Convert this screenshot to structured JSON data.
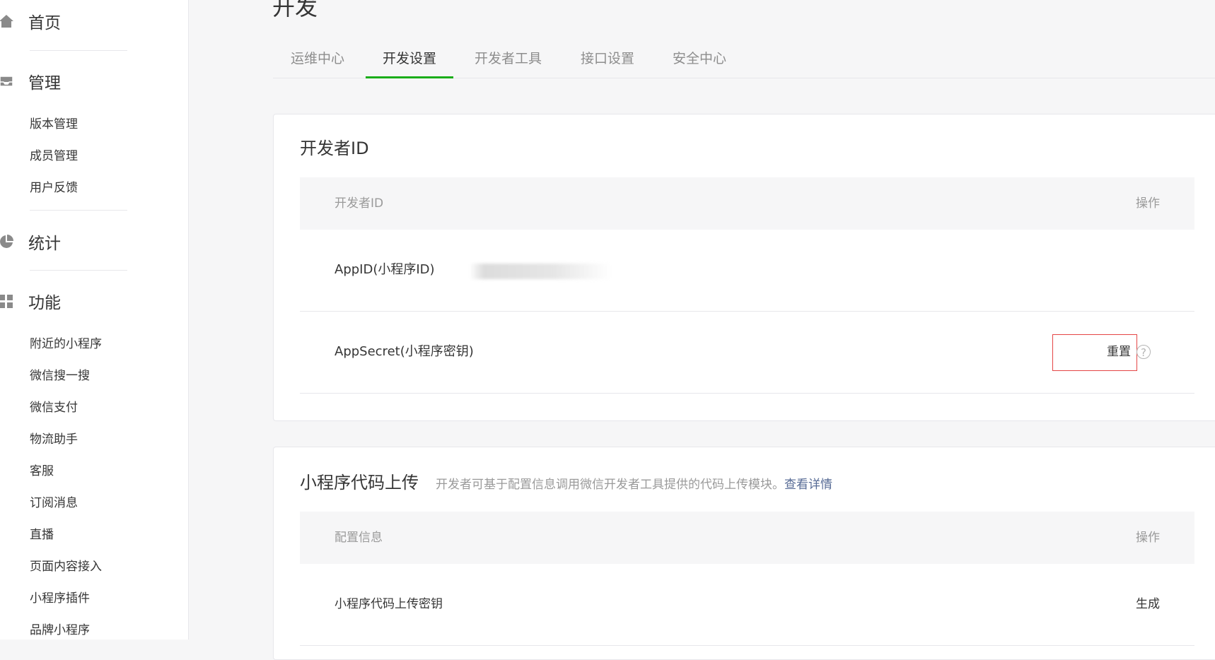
{
  "sidebar": {
    "home": "首页",
    "manage": {
      "title": "管理",
      "items": [
        "版本管理",
        "成员管理",
        "用户反馈"
      ]
    },
    "stats": "统计",
    "features": {
      "title": "功能",
      "items": [
        "附近的小程序",
        "微信搜一搜",
        "微信支付",
        "物流助手",
        "客服",
        "订阅消息",
        "直播",
        "页面内容接入",
        "小程序插件",
        "品牌小程序"
      ]
    }
  },
  "page": {
    "title": "开发"
  },
  "tabs": [
    "运维中心",
    "开发设置",
    "开发者工具",
    "接口设置",
    "安全中心"
  ],
  "dev_id_card": {
    "title": "开发者ID",
    "header": {
      "col1": "开发者ID",
      "col2": "操作"
    },
    "rows": [
      {
        "label": "AppID(小程序ID)"
      },
      {
        "label": "AppSecret(小程序密钥)",
        "action": "重置",
        "help": "?"
      }
    ]
  },
  "upload_card": {
    "title": "小程序代码上传",
    "desc": "开发者可基于配置信息调用微信开发者工具提供的代码上传模块。",
    "desc_link": "查看详情",
    "header": {
      "col1": "配置信息",
      "col2": "操作"
    },
    "rows": [
      {
        "label": "小程序代码上传密钥",
        "action": "生成"
      }
    ]
  },
  "colors": {
    "accent": "#1aad19",
    "link": "#576b95",
    "highlight": "#e54545"
  }
}
